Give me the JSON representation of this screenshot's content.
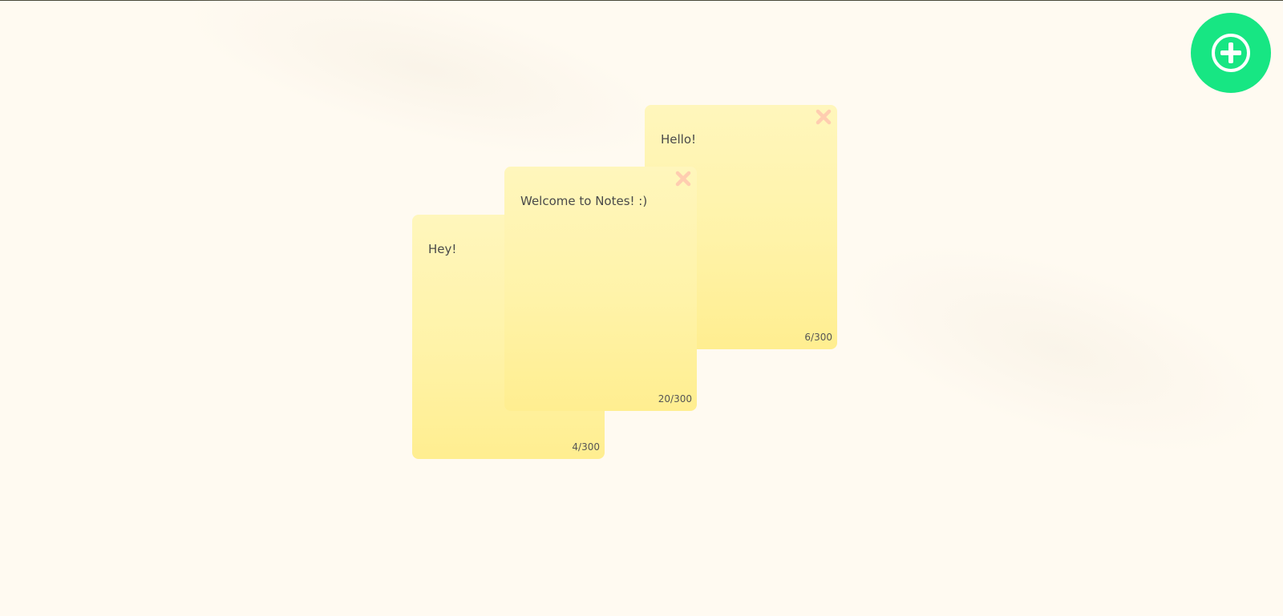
{
  "app": {
    "add_note_icon": "plus-circle-icon",
    "accent_color": "#17e683",
    "background_color": "#fffaf1"
  },
  "notes": [
    {
      "text": "Hey!",
      "count": "4/300",
      "has_close": false
    },
    {
      "text": "Welcome to Notes! :)",
      "count": "20/300",
      "has_close": true,
      "close_icon": "close-icon"
    },
    {
      "text": "Hello!",
      "count": "6/300",
      "has_close": true,
      "close_icon": "close-icon"
    }
  ],
  "colors": {
    "note_top": "#fff6bc",
    "note_bottom": "#ffee90",
    "close_icon": "#ffcdb0",
    "note_text": "#4a4a4a"
  }
}
